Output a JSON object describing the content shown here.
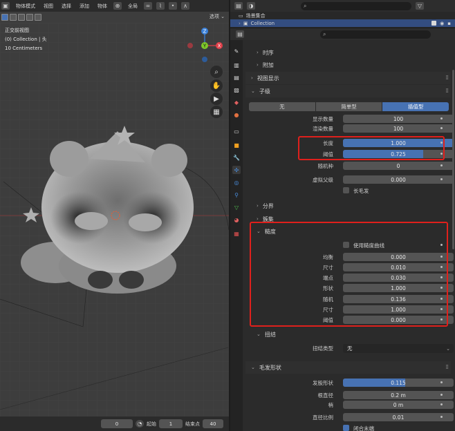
{
  "viewport": {
    "mode": "物体模式",
    "menus": [
      "视图",
      "选择",
      "添加",
      "物体"
    ],
    "transform_orientation": "全局",
    "options_label": "选项",
    "info": [
      "正交前视图",
      "(0) Collection | 头",
      "10 Centimeters"
    ],
    "gizmo": {
      "z": "Z",
      "y": "Y",
      "x": "X"
    }
  },
  "timeline": {
    "current_frame": "0",
    "start_label": "起始",
    "start_value": "1",
    "end_label": "结束点",
    "end_value": "40"
  },
  "outliner": {
    "scene_collection": "场景集合",
    "collection": "Collection"
  },
  "properties": {
    "panels": {
      "timing": "时序",
      "attach": "附加",
      "viewport_display": "视图显示",
      "children": "子级",
      "clumping": "分界",
      "roughness_group": "簇集",
      "roughness": "糙度",
      "kink": "扭结",
      "hair_shape": "毛发形状"
    },
    "children_type": {
      "options": [
        "无",
        "简单型",
        "插值型"
      ],
      "selected": "插值型"
    },
    "children_rows": [
      {
        "label": "显示数量",
        "value": "100"
      },
      {
        "label": "渲染数量",
        "value": "100"
      },
      {
        "label": "长度",
        "value": "1.000",
        "fill": 1.0
      },
      {
        "label": "阈值",
        "value": "0.725",
        "fill": 0.725
      },
      {
        "label": "随机种",
        "value": "0"
      },
      {
        "label": "虚拟父级",
        "value": "0.000"
      }
    ],
    "long_hair_label": "长毛发",
    "use_roughness_curve_label": "使用糙度曲线",
    "roughness_rows": [
      {
        "label": "均衡",
        "value": "0.000"
      },
      {
        "label": "尺寸",
        "value": "0.010"
      },
      {
        "label": "端点",
        "value": "0.030"
      },
      {
        "label": "形状",
        "value": "1.000"
      },
      {
        "label": "随机",
        "value": "0.136"
      },
      {
        "label": "尺寸",
        "value": "1.000"
      },
      {
        "label": "阈值",
        "value": "0.000"
      }
    ],
    "kink_type_label": "扭结类型",
    "kink_type_value": "无",
    "hair_shape_rows": [
      {
        "label": "发股形状",
        "value": "0.115",
        "fill": 0.56
      },
      {
        "label": "根直径",
        "value": "0.2 m"
      },
      {
        "label": "梢",
        "value": "0 m"
      },
      {
        "label": "直径比例",
        "value": "0.01"
      }
    ],
    "close_tip_label": "闭合末端"
  },
  "colors": {
    "accent": "#4772b3",
    "highlight_box": "#e0201c",
    "x_axis": "#e0404a",
    "y_axis": "#7ec82a",
    "z_axis": "#3a80d9"
  }
}
